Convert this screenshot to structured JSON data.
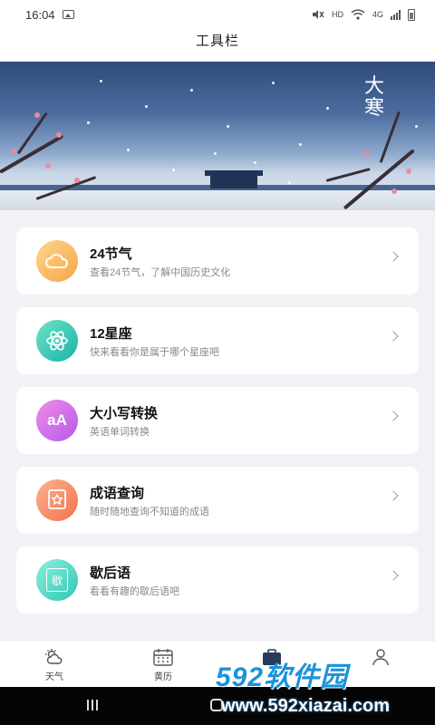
{
  "status_bar": {
    "time": "16:04",
    "hd_label": "HD",
    "network_label": "4G"
  },
  "header": {
    "title": "工具栏"
  },
  "banner": {
    "calligraphy": "大寒"
  },
  "tools": [
    {
      "title": "24节气",
      "subtitle": "查看24节气，了解中国历史文化",
      "icon": "weather-cloud-icon"
    },
    {
      "title": "12星座",
      "subtitle": "快来看看你是属于哪个星座吧",
      "icon": "atom-icon"
    },
    {
      "title": "大小写转换",
      "subtitle": "英语单词转换",
      "icon": "letter-case-icon",
      "icon_text": "aA"
    },
    {
      "title": "成语查询",
      "subtitle": "随时随地查询不知道的成语",
      "icon": "star-frame-icon"
    },
    {
      "title": "歇后语",
      "subtitle": "看看有趣的歇后语吧",
      "icon": "book-icon",
      "icon_text": "歇"
    }
  ],
  "tabbar": {
    "tabs": [
      {
        "label": "天气",
        "icon": "weather-icon"
      },
      {
        "label": "黄历",
        "icon": "calendar-icon"
      },
      {
        "label": "",
        "icon": "toolbox-icon"
      },
      {
        "label": "",
        "icon": "user-icon"
      }
    ]
  },
  "watermark": {
    "brand": "592软件园",
    "url": "www.592xiazai.com"
  },
  "colors": {
    "page_background": "#f1f1f6",
    "watermark_blue": "#1b93d8",
    "solar_terms_icon": "#f4a74c",
    "zodiac_icon": "#19b3a8",
    "case_convert_icon": "#b65ae8",
    "idiom_icon": "#f0744f",
    "xiehouyu_icon": "#2fc6b8"
  }
}
